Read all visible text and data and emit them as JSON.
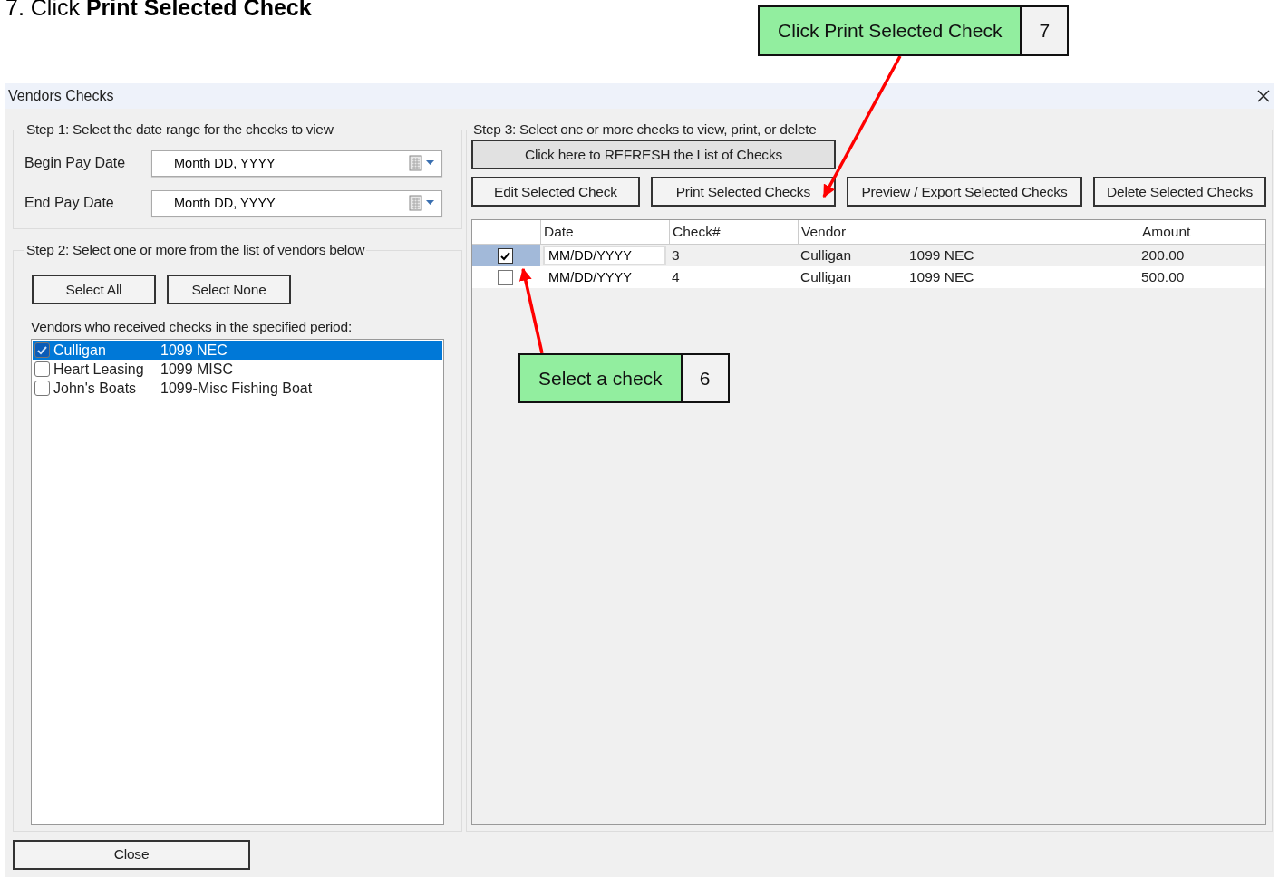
{
  "heading": "7. Click **Print Selected Check**",
  "callouts": [
    {
      "text": "Click Print Selected Check",
      "step": "7"
    },
    {
      "text": "Select a check",
      "step": "6"
    }
  ],
  "window": {
    "title": "Vendors Checks"
  },
  "step1": {
    "legend": "Step 1: Select the date range for the checks to view",
    "fields": [
      {
        "label": "Begin Pay Date",
        "value": "Month DD, YYYY"
      },
      {
        "label": "End Pay Date",
        "value": "Month DD, YYYY"
      }
    ]
  },
  "step2": {
    "legend": "Step 2: Select one or more from the list of vendors below",
    "buttons": [
      "Select All",
      "Select None"
    ],
    "list_label": "Vendors who received checks in the specified period:",
    "vendors": [
      {
        "name": "Culligan",
        "form": "1099 NEC",
        "checked": true,
        "selected": true
      },
      {
        "name": "Heart Leasing",
        "form": "1099 MISC",
        "checked": false,
        "selected": false
      },
      {
        "name": "John's Boats",
        "form": "1099-Misc Fishing Boat",
        "checked": false,
        "selected": false
      }
    ]
  },
  "step3": {
    "legend": "Step 3: Select one or more checks to view, print, or delete",
    "refresh_button": "Click here to REFRESH the List of Checks",
    "buttons": [
      "Edit Selected Check",
      "Print Selected Checks",
      "Preview / Export Selected Checks",
      "Delete Selected Checks"
    ],
    "grid": {
      "columns": [
        "Date",
        "Check#",
        "Vendor",
        "Amount"
      ],
      "rows": [
        {
          "checked": true,
          "selected": true,
          "date": "MM/DD/YYYY",
          "check": "3",
          "vendor": "Culligan",
          "form": "1099 NEC",
          "amount": "200.00"
        },
        {
          "checked": false,
          "selected": false,
          "date": "MM/DD/YYYY",
          "check": "4",
          "vendor": "Culligan",
          "form": "1099 NEC",
          "amount": "500.00"
        }
      ]
    }
  },
  "close_button": "Close"
}
